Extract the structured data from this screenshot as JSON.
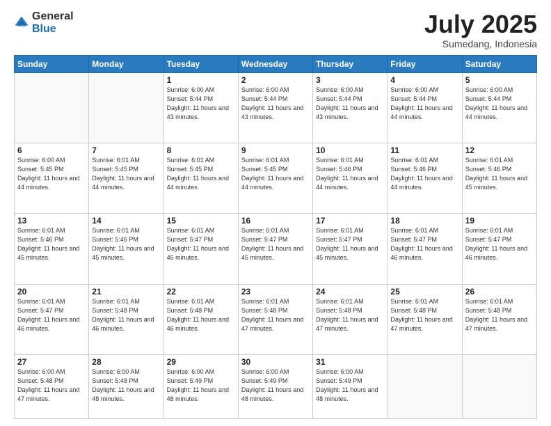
{
  "header": {
    "logo": {
      "general": "General",
      "blue": "Blue"
    },
    "title": "July 2025",
    "subtitle": "Sumedang, Indonesia"
  },
  "weekdays": [
    "Sunday",
    "Monday",
    "Tuesday",
    "Wednesday",
    "Thursday",
    "Friday",
    "Saturday"
  ],
  "weeks": [
    [
      {
        "day": "",
        "info": ""
      },
      {
        "day": "",
        "info": ""
      },
      {
        "day": "1",
        "info": "Sunrise: 6:00 AM\nSunset: 5:44 PM\nDaylight: 11 hours and 43 minutes."
      },
      {
        "day": "2",
        "info": "Sunrise: 6:00 AM\nSunset: 5:44 PM\nDaylight: 11 hours and 43 minutes."
      },
      {
        "day": "3",
        "info": "Sunrise: 6:00 AM\nSunset: 5:44 PM\nDaylight: 11 hours and 43 minutes."
      },
      {
        "day": "4",
        "info": "Sunrise: 6:00 AM\nSunset: 5:44 PM\nDaylight: 11 hours and 44 minutes."
      },
      {
        "day": "5",
        "info": "Sunrise: 6:00 AM\nSunset: 5:44 PM\nDaylight: 11 hours and 44 minutes."
      }
    ],
    [
      {
        "day": "6",
        "info": "Sunrise: 6:00 AM\nSunset: 5:45 PM\nDaylight: 11 hours and 44 minutes."
      },
      {
        "day": "7",
        "info": "Sunrise: 6:01 AM\nSunset: 5:45 PM\nDaylight: 11 hours and 44 minutes."
      },
      {
        "day": "8",
        "info": "Sunrise: 6:01 AM\nSunset: 5:45 PM\nDaylight: 11 hours and 44 minutes."
      },
      {
        "day": "9",
        "info": "Sunrise: 6:01 AM\nSunset: 5:45 PM\nDaylight: 11 hours and 44 minutes."
      },
      {
        "day": "10",
        "info": "Sunrise: 6:01 AM\nSunset: 5:46 PM\nDaylight: 11 hours and 44 minutes."
      },
      {
        "day": "11",
        "info": "Sunrise: 6:01 AM\nSunset: 5:46 PM\nDaylight: 11 hours and 44 minutes."
      },
      {
        "day": "12",
        "info": "Sunrise: 6:01 AM\nSunset: 5:46 PM\nDaylight: 11 hours and 45 minutes."
      }
    ],
    [
      {
        "day": "13",
        "info": "Sunrise: 6:01 AM\nSunset: 5:46 PM\nDaylight: 11 hours and 45 minutes."
      },
      {
        "day": "14",
        "info": "Sunrise: 6:01 AM\nSunset: 5:46 PM\nDaylight: 11 hours and 45 minutes."
      },
      {
        "day": "15",
        "info": "Sunrise: 6:01 AM\nSunset: 5:47 PM\nDaylight: 11 hours and 45 minutes."
      },
      {
        "day": "16",
        "info": "Sunrise: 6:01 AM\nSunset: 5:47 PM\nDaylight: 11 hours and 45 minutes."
      },
      {
        "day": "17",
        "info": "Sunrise: 6:01 AM\nSunset: 5:47 PM\nDaylight: 11 hours and 45 minutes."
      },
      {
        "day": "18",
        "info": "Sunrise: 6:01 AM\nSunset: 5:47 PM\nDaylight: 11 hours and 46 minutes."
      },
      {
        "day": "19",
        "info": "Sunrise: 6:01 AM\nSunset: 5:47 PM\nDaylight: 11 hours and 46 minutes."
      }
    ],
    [
      {
        "day": "20",
        "info": "Sunrise: 6:01 AM\nSunset: 5:47 PM\nDaylight: 11 hours and 46 minutes."
      },
      {
        "day": "21",
        "info": "Sunrise: 6:01 AM\nSunset: 5:48 PM\nDaylight: 11 hours and 46 minutes."
      },
      {
        "day": "22",
        "info": "Sunrise: 6:01 AM\nSunset: 5:48 PM\nDaylight: 11 hours and 46 minutes."
      },
      {
        "day": "23",
        "info": "Sunrise: 6:01 AM\nSunset: 5:48 PM\nDaylight: 11 hours and 47 minutes."
      },
      {
        "day": "24",
        "info": "Sunrise: 6:01 AM\nSunset: 5:48 PM\nDaylight: 11 hours and 47 minutes."
      },
      {
        "day": "25",
        "info": "Sunrise: 6:01 AM\nSunset: 5:48 PM\nDaylight: 11 hours and 47 minutes."
      },
      {
        "day": "26",
        "info": "Sunrise: 6:01 AM\nSunset: 5:48 PM\nDaylight: 11 hours and 47 minutes."
      }
    ],
    [
      {
        "day": "27",
        "info": "Sunrise: 6:00 AM\nSunset: 5:48 PM\nDaylight: 11 hours and 47 minutes."
      },
      {
        "day": "28",
        "info": "Sunrise: 6:00 AM\nSunset: 5:48 PM\nDaylight: 11 hours and 48 minutes."
      },
      {
        "day": "29",
        "info": "Sunrise: 6:00 AM\nSunset: 5:49 PM\nDaylight: 11 hours and 48 minutes."
      },
      {
        "day": "30",
        "info": "Sunrise: 6:00 AM\nSunset: 5:49 PM\nDaylight: 11 hours and 48 minutes."
      },
      {
        "day": "31",
        "info": "Sunrise: 6:00 AM\nSunset: 5:49 PM\nDaylight: 11 hours and 48 minutes."
      },
      {
        "day": "",
        "info": ""
      },
      {
        "day": "",
        "info": ""
      }
    ]
  ]
}
